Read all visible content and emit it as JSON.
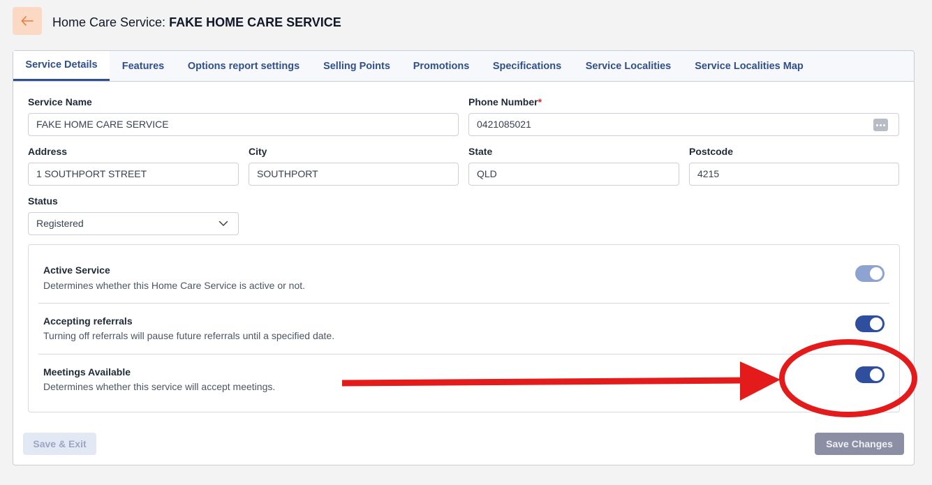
{
  "header": {
    "back_icon": "arrow-left-icon",
    "title_prefix": "Home Care Service:",
    "title_name": "FAKE HOME CARE SERVICE"
  },
  "tabs": [
    {
      "label": "Service Details",
      "active": true
    },
    {
      "label": "Features",
      "active": false
    },
    {
      "label": "Options report settings",
      "active": false
    },
    {
      "label": "Selling Points",
      "active": false
    },
    {
      "label": "Promotions",
      "active": false
    },
    {
      "label": "Specifications",
      "active": false
    },
    {
      "label": "Service Localities",
      "active": false
    },
    {
      "label": "Service Localities Map",
      "active": false
    }
  ],
  "form": {
    "service_name": {
      "label": "Service Name",
      "value": "FAKE HOME CARE SERVICE"
    },
    "phone_number": {
      "label": "Phone Number",
      "required_mark": "*",
      "value": "0421085021"
    },
    "address": {
      "label": "Address",
      "value": "1 SOUTHPORT STREET"
    },
    "city": {
      "label": "City",
      "value": "SOUTHPORT"
    },
    "state": {
      "label": "State",
      "value": "QLD"
    },
    "postcode": {
      "label": "Postcode",
      "value": "4215"
    },
    "status": {
      "label": "Status",
      "value": "Registered"
    }
  },
  "toggles": [
    {
      "title": "Active Service",
      "description": "Determines whether this Home Care Service is active or not.",
      "on": true,
      "disabled": true
    },
    {
      "title": "Accepting referrals",
      "description": "Turning off referrals will pause future referrals until a specified date.",
      "on": true,
      "disabled": false
    },
    {
      "title": "Meetings Available",
      "description": "Determines whether this service will accept meetings.",
      "on": true,
      "disabled": false
    }
  ],
  "footer": {
    "save_exit_label": "Save & Exit",
    "save_changes_label": "Save Changes"
  },
  "colors": {
    "accent": "#2f4f8f",
    "toggle_on": "#2f4f9e",
    "toggle_disabled": "#8ea3cf",
    "back_button_bg": "#fbd9c4",
    "annotation_red": "#e31b1b"
  }
}
